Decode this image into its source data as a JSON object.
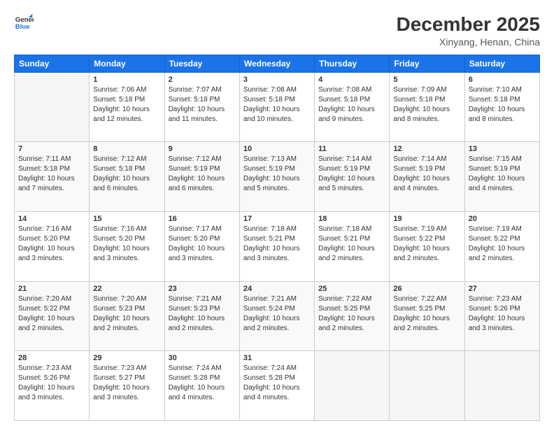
{
  "header": {
    "logo_line1": "General",
    "logo_line2": "Blue",
    "month_year": "December 2025",
    "location": "Xinyang, Henan, China"
  },
  "weekdays": [
    "Sunday",
    "Monday",
    "Tuesday",
    "Wednesday",
    "Thursday",
    "Friday",
    "Saturday"
  ],
  "weeks": [
    [
      {
        "day": "",
        "info": ""
      },
      {
        "day": "1",
        "info": "Sunrise: 7:06 AM\nSunset: 5:18 PM\nDaylight: 10 hours\nand 12 minutes."
      },
      {
        "day": "2",
        "info": "Sunrise: 7:07 AM\nSunset: 5:18 PM\nDaylight: 10 hours\nand 11 minutes."
      },
      {
        "day": "3",
        "info": "Sunrise: 7:08 AM\nSunset: 5:18 PM\nDaylight: 10 hours\nand 10 minutes."
      },
      {
        "day": "4",
        "info": "Sunrise: 7:08 AM\nSunset: 5:18 PM\nDaylight: 10 hours\nand 9 minutes."
      },
      {
        "day": "5",
        "info": "Sunrise: 7:09 AM\nSunset: 5:18 PM\nDaylight: 10 hours\nand 8 minutes."
      },
      {
        "day": "6",
        "info": "Sunrise: 7:10 AM\nSunset: 5:18 PM\nDaylight: 10 hours\nand 8 minutes."
      }
    ],
    [
      {
        "day": "7",
        "info": "Sunrise: 7:11 AM\nSunset: 5:18 PM\nDaylight: 10 hours\nand 7 minutes."
      },
      {
        "day": "8",
        "info": "Sunrise: 7:12 AM\nSunset: 5:18 PM\nDaylight: 10 hours\nand 6 minutes."
      },
      {
        "day": "9",
        "info": "Sunrise: 7:12 AM\nSunset: 5:19 PM\nDaylight: 10 hours\nand 6 minutes."
      },
      {
        "day": "10",
        "info": "Sunrise: 7:13 AM\nSunset: 5:19 PM\nDaylight: 10 hours\nand 5 minutes."
      },
      {
        "day": "11",
        "info": "Sunrise: 7:14 AM\nSunset: 5:19 PM\nDaylight: 10 hours\nand 5 minutes."
      },
      {
        "day": "12",
        "info": "Sunrise: 7:14 AM\nSunset: 5:19 PM\nDaylight: 10 hours\nand 4 minutes."
      },
      {
        "day": "13",
        "info": "Sunrise: 7:15 AM\nSunset: 5:19 PM\nDaylight: 10 hours\nand 4 minutes."
      }
    ],
    [
      {
        "day": "14",
        "info": "Sunrise: 7:16 AM\nSunset: 5:20 PM\nDaylight: 10 hours\nand 3 minutes."
      },
      {
        "day": "15",
        "info": "Sunrise: 7:16 AM\nSunset: 5:20 PM\nDaylight: 10 hours\nand 3 minutes."
      },
      {
        "day": "16",
        "info": "Sunrise: 7:17 AM\nSunset: 5:20 PM\nDaylight: 10 hours\nand 3 minutes."
      },
      {
        "day": "17",
        "info": "Sunrise: 7:18 AM\nSunset: 5:21 PM\nDaylight: 10 hours\nand 3 minutes."
      },
      {
        "day": "18",
        "info": "Sunrise: 7:18 AM\nSunset: 5:21 PM\nDaylight: 10 hours\nand 2 minutes."
      },
      {
        "day": "19",
        "info": "Sunrise: 7:19 AM\nSunset: 5:22 PM\nDaylight: 10 hours\nand 2 minutes."
      },
      {
        "day": "20",
        "info": "Sunrise: 7:19 AM\nSunset: 5:22 PM\nDaylight: 10 hours\nand 2 minutes."
      }
    ],
    [
      {
        "day": "21",
        "info": "Sunrise: 7:20 AM\nSunset: 5:22 PM\nDaylight: 10 hours\nand 2 minutes."
      },
      {
        "day": "22",
        "info": "Sunrise: 7:20 AM\nSunset: 5:23 PM\nDaylight: 10 hours\nand 2 minutes."
      },
      {
        "day": "23",
        "info": "Sunrise: 7:21 AM\nSunset: 5:23 PM\nDaylight: 10 hours\nand 2 minutes."
      },
      {
        "day": "24",
        "info": "Sunrise: 7:21 AM\nSunset: 5:24 PM\nDaylight: 10 hours\nand 2 minutes."
      },
      {
        "day": "25",
        "info": "Sunrise: 7:22 AM\nSunset: 5:25 PM\nDaylight: 10 hours\nand 2 minutes."
      },
      {
        "day": "26",
        "info": "Sunrise: 7:22 AM\nSunset: 5:25 PM\nDaylight: 10 hours\nand 2 minutes."
      },
      {
        "day": "27",
        "info": "Sunrise: 7:23 AM\nSunset: 5:26 PM\nDaylight: 10 hours\nand 3 minutes."
      }
    ],
    [
      {
        "day": "28",
        "info": "Sunrise: 7:23 AM\nSunset: 5:26 PM\nDaylight: 10 hours\nand 3 minutes."
      },
      {
        "day": "29",
        "info": "Sunrise: 7:23 AM\nSunset: 5:27 PM\nDaylight: 10 hours\nand 3 minutes."
      },
      {
        "day": "30",
        "info": "Sunrise: 7:24 AM\nSunset: 5:28 PM\nDaylight: 10 hours\nand 4 minutes."
      },
      {
        "day": "31",
        "info": "Sunrise: 7:24 AM\nSunset: 5:28 PM\nDaylight: 10 hours\nand 4 minutes."
      },
      {
        "day": "",
        "info": ""
      },
      {
        "day": "",
        "info": ""
      },
      {
        "day": "",
        "info": ""
      }
    ]
  ]
}
